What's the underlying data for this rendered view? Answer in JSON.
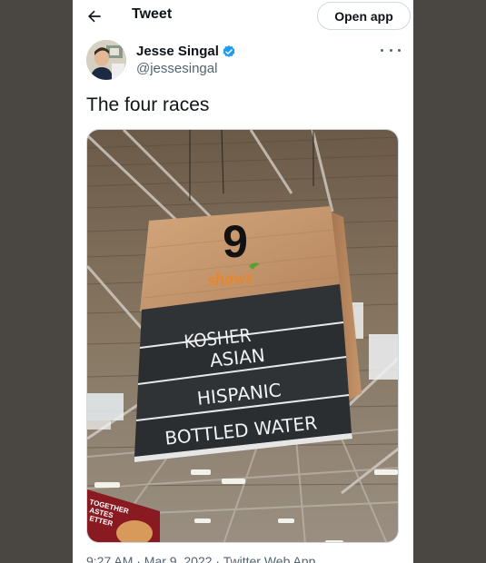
{
  "header": {
    "title": "Tweet",
    "open_app_label": "Open app",
    "back_icon": "back-arrow-icon"
  },
  "author": {
    "name": "Jesse Singal",
    "handle": "@jessesingal",
    "verified": true
  },
  "tweet": {
    "text": "The four races"
  },
  "media": {
    "sign_number": "9",
    "store_logo": "shaws",
    "aisle_items": [
      "KOSHER",
      "ASIAN",
      "HISPANIC",
      "BOTTLED WATER"
    ],
    "poster_text": [
      "TOGETHER",
      "ASTES",
      "ETTER"
    ]
  },
  "meta": {
    "text": "9:27 AM · Mar 9, 2022 · Twitter Web App"
  },
  "colors": {
    "verified": "#1d9bf0",
    "sign_wood": "#c89a6f",
    "sign_panel": "#2f3336",
    "logo_orange": "#e8862a"
  }
}
